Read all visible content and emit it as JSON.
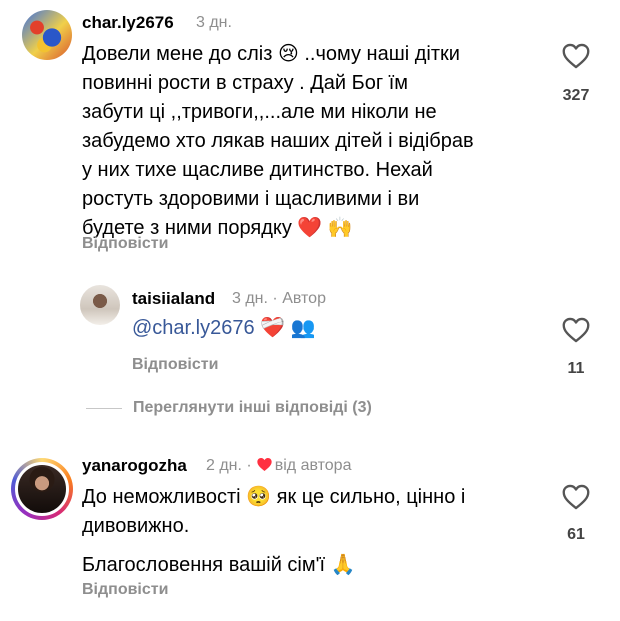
{
  "comments": [
    {
      "username": "char.ly2676",
      "time": "3 дн.",
      "lines": [
        "Довели мене до сліз 😢 ..чому наші дітки",
        "повинні рости в страху . Дай Бог їм",
        "забути ці ,,тривоги,,...але ми ніколи не",
        "забудемо хто лякав наших дітей і відібрав",
        "у них тихе щасливе дитинство. Нехай",
        "ростуть здоровими і щасливими і ви",
        "будете з ними порядку ❤️ 🙌"
      ],
      "reply_label": "Відповісти",
      "likes": "327"
    },
    {
      "username": "taisiialand",
      "time": "3 дн.",
      "separator": "·",
      "author_tag": "Автор",
      "mention": "@char.ly2676",
      "emojis": "❤️‍🩹 👥",
      "reply_label": "Відповісти",
      "likes": "11"
    },
    {
      "username": "yanarogozha",
      "time": "2 дн.",
      "separator": "·",
      "liked_by_author": "від автора",
      "lines": [
        "До неможливості 🥺  як це сильно, цінно і",
        "дивовижно."
      ],
      "extra_line": "Благословення вашій сім'ї 🙏",
      "reply_label": "Відповісти",
      "likes": "61"
    }
  ],
  "view_more_replies": "Переглянути інші відповіді (3)",
  "colors": {
    "secondary": "#8e8e8e",
    "mention": "#385898",
    "heart_red": "#ff3040"
  },
  "icons": [
    "heart-outline-icon",
    "heart-filled-icon"
  ]
}
